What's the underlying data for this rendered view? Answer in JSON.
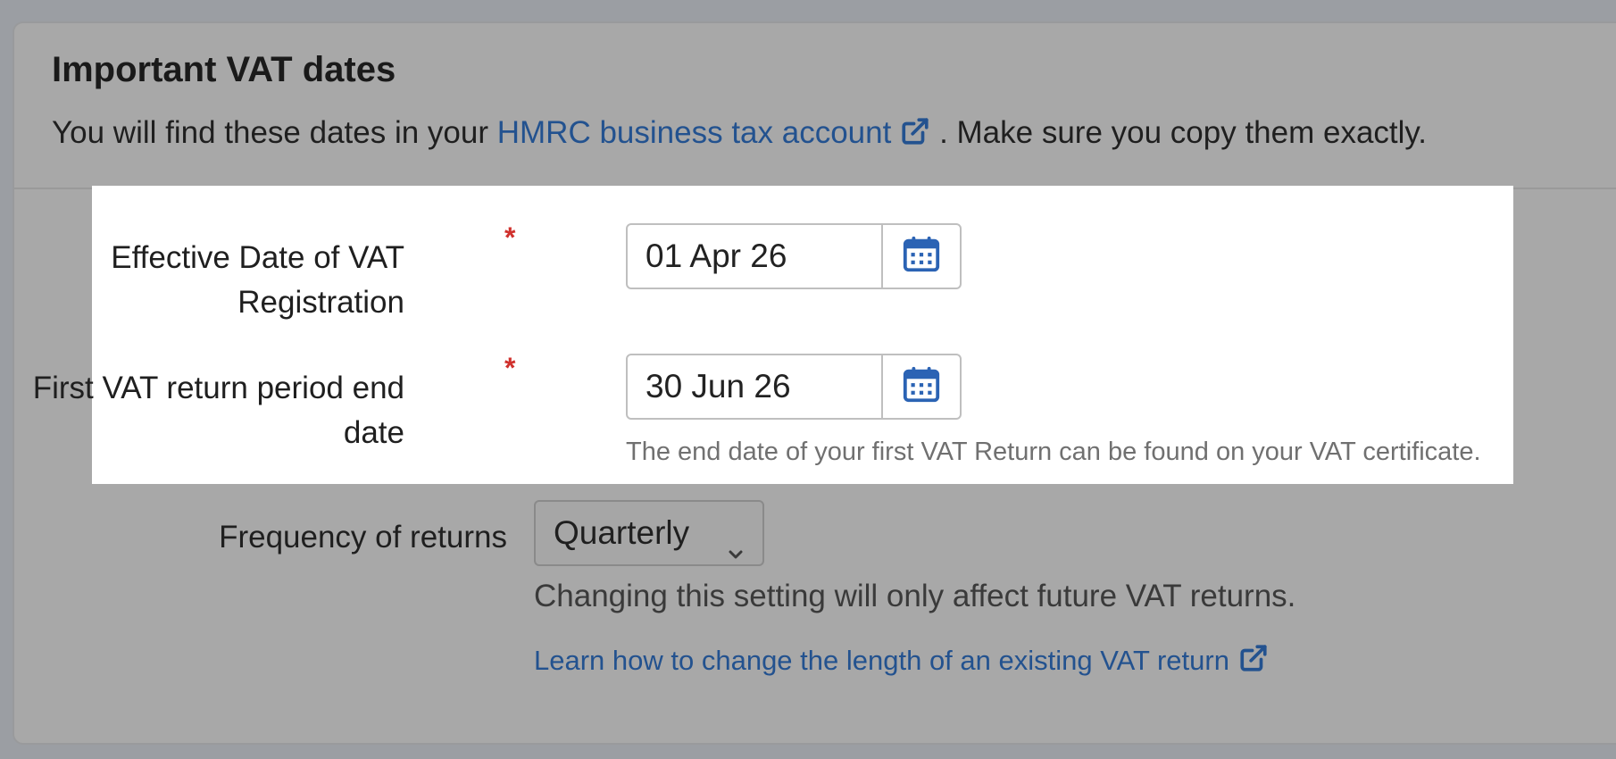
{
  "section": {
    "title": "Important VAT dates",
    "desc_before": "You will find these dates in your",
    "desc_link": "HMRC business tax account",
    "desc_after": ". Make sure you copy them exactly."
  },
  "fields": {
    "effective_date": {
      "label_line1": "Effective Date of VAT",
      "label_line2": "Registration",
      "required_mark": "*",
      "value": "01 Apr 26"
    },
    "first_return_end": {
      "label_line1": "First VAT return period end",
      "label_line2": "date",
      "required_mark": "*",
      "value": "30 Jun 26",
      "hint": "The end date of your first VAT Return can be found on your VAT certificate."
    },
    "frequency": {
      "label": "Frequency of returns",
      "selected": "Quarterly",
      "help": "Changing this setting will only affect future VAT returns.",
      "link": "Learn how to change the length of an existing VAT return"
    }
  },
  "colors": {
    "link": "#23528f",
    "required": "#d0312d",
    "calendar_icon": "#2b63b4"
  },
  "icons": {
    "calendar": "calendar-icon",
    "external_link": "external-link-icon",
    "dropdown": "chevron-down-icon"
  }
}
